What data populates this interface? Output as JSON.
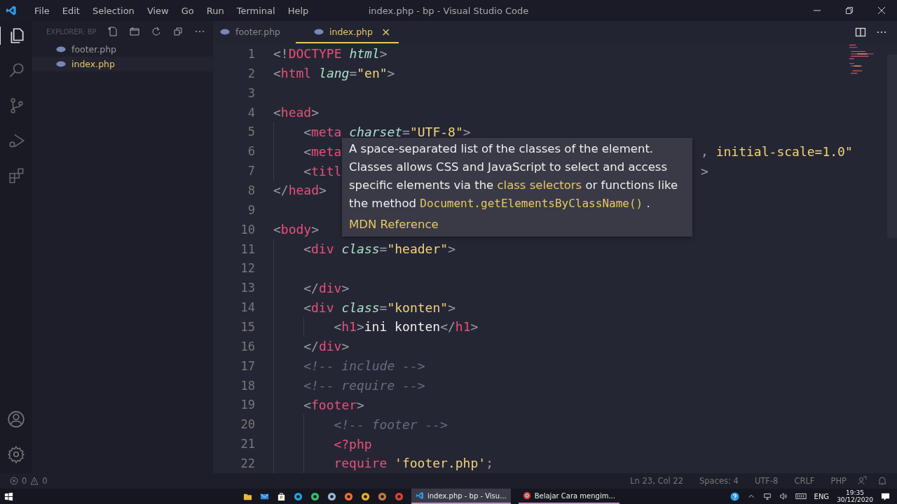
{
  "window": {
    "title": "index.php - bp - Visual Studio Code"
  },
  "menu": [
    "File",
    "Edit",
    "Selection",
    "View",
    "Go",
    "Run",
    "Terminal",
    "Help"
  ],
  "activity_bar": [
    {
      "kind": "files",
      "selected": true
    },
    {
      "kind": "search",
      "selected": false
    },
    {
      "kind": "branch",
      "selected": false
    },
    {
      "kind": "debug",
      "selected": false
    },
    {
      "kind": "extensions",
      "selected": false
    }
  ],
  "sidebar": {
    "title": "EXPLORER: BP",
    "files": [
      {
        "name": "footer.php",
        "selected": false
      },
      {
        "name": "index.php",
        "selected": true
      }
    ]
  },
  "tabs": [
    {
      "label": "footer.php",
      "selected": false
    },
    {
      "label": "index.php",
      "selected": true,
      "close": "×"
    }
  ],
  "code": [
    {
      "num": "1",
      "tokens": [
        {
          "kind": "p",
          "t": "<!"
        },
        {
          "kind": "tag",
          "t": "DOCTYPE"
        },
        {
          "kind": "attr",
          "t": " html"
        },
        {
          "kind": "p",
          "t": ">"
        }
      ]
    },
    {
      "num": "2",
      "tokens": [
        {
          "kind": "p",
          "t": "<"
        },
        {
          "kind": "tag",
          "t": "html"
        },
        {
          "kind": "attr",
          "t": " lang"
        },
        {
          "kind": "p",
          "t": "="
        },
        {
          "kind": "str",
          "t": "\"en\""
        },
        {
          "kind": "p",
          "t": ">"
        }
      ]
    },
    {
      "num": "3"
    },
    {
      "num": "4",
      "tokens": [
        {
          "kind": "p",
          "t": "<"
        },
        {
          "kind": "tag",
          "t": "head"
        },
        {
          "kind": "p",
          "t": ">"
        }
      ],
      "children": [
        {
          "num": "5",
          "tokens": [
            {
              "kind": "p",
              "t": "<"
            },
            {
              "kind": "tag",
              "t": "meta"
            },
            {
              "kind": "attr",
              "t": " charset"
            },
            {
              "kind": "p",
              "t": "="
            },
            {
              "kind": "str",
              "t": "\"UTF-8\""
            },
            {
              "kind": "p",
              "t": ">"
            }
          ]
        },
        {
          "num": "6",
          "tokens": [
            {
              "kind": "p",
              "t": "<"
            },
            {
              "kind": "tag",
              "t": "meta"
            }
          ],
          "tail": [
            {
              "kind": "p",
              "t": ", "
            },
            {
              "kind": "str",
              "t": "initial-scale=1.0\""
            }
          ]
        },
        {
          "num": "7",
          "tokens": [
            {
              "kind": "p",
              "t": "<"
            },
            {
              "kind": "tag",
              "t": "titl"
            }
          ],
          "tail": [
            {
              "kind": "p",
              "t": ">"
            }
          ]
        }
      ]
    },
    {
      "num": "8",
      "tokens": [
        {
          "kind": "p",
          "t": "</"
        },
        {
          "kind": "tag",
          "t": "head"
        },
        {
          "kind": "p",
          "t": ">"
        }
      ]
    },
    {
      "num": "9"
    },
    {
      "num": "10",
      "tokens": [
        {
          "kind": "p",
          "t": "<"
        },
        {
          "kind": "tag",
          "t": "body"
        },
        {
          "kind": "p",
          "t": ">"
        }
      ],
      "children": [
        {
          "num": "11",
          "tokens": [
            {
              "kind": "p",
              "t": "<"
            },
            {
              "kind": "tag",
              "t": "div"
            },
            {
              "kind": "attr",
              "t": " class"
            },
            {
              "kind": "p",
              "t": "="
            },
            {
              "kind": "str",
              "t": "\"header\""
            },
            {
              "kind": "p",
              "t": ">"
            }
          ]
        },
        {
          "num": "12"
        },
        {
          "num": "13",
          "tokens": [
            {
              "kind": "p",
              "t": "</"
            },
            {
              "kind": "tag",
              "t": "div"
            },
            {
              "kind": "p",
              "t": ">"
            }
          ]
        },
        {
          "num": "14",
          "tokens": [
            {
              "kind": "p",
              "t": "<"
            },
            {
              "kind": "tag",
              "t": "div"
            },
            {
              "kind": "attr",
              "t": " class"
            },
            {
              "kind": "p",
              "t": "="
            },
            {
              "kind": "str",
              "t": "\"konten\""
            },
            {
              "kind": "p",
              "t": ">"
            }
          ],
          "children": [
            {
              "num": "15",
              "tokens": [
                {
                  "kind": "p",
                  "t": "<"
                },
                {
                  "kind": "tag",
                  "t": "h1"
                },
                {
                  "kind": "p",
                  "t": ">"
                },
                {
                  "kind": "x",
                  "t": "ini konten"
                },
                {
                  "kind": "p",
                  "t": "</"
                },
                {
                  "kind": "tag",
                  "t": "h1"
                },
                {
                  "kind": "p",
                  "t": ">"
                }
              ]
            }
          ]
        },
        {
          "num": "16",
          "tokens": [
            {
              "kind": "p",
              "t": "</"
            },
            {
              "kind": "tag",
              "t": "div"
            },
            {
              "kind": "p",
              "t": ">"
            }
          ]
        },
        {
          "num": "17",
          "tokens": [
            {
              "kind": "c",
              "t": "<!-- include -->"
            }
          ]
        },
        {
          "num": "18",
          "tokens": [
            {
              "kind": "c",
              "t": "<!-- require -->"
            }
          ]
        },
        {
          "num": "19",
          "tokens": [
            {
              "kind": "p",
              "t": "<"
            },
            {
              "kind": "tag",
              "t": "footer"
            },
            {
              "kind": "p",
              "t": ">"
            }
          ],
          "children": [
            {
              "num": "20",
              "tokens": [
                {
                  "kind": "c",
                  "t": "<!-- footer -->"
                }
              ]
            },
            {
              "num": "21",
              "tokens": [
                {
                  "kind": "tag",
                  "t": "<?php"
                }
              ]
            },
            {
              "num": "22",
              "tokens": [
                {
                  "kind": "tag",
                  "t": "require"
                },
                {
                  "kind": "str",
                  "t": " 'footer.php'"
                },
                {
                  "kind": "p",
                  "t": ";"
                }
              ]
            }
          ]
        }
      ]
    }
  ],
  "hover": {
    "parts": [
      {
        "kind": "text",
        "t": "A space-separated list of the classes of the element. Classes allows CSS and JavaScript to select and access specific elements via the "
      },
      {
        "kind": "link",
        "t": "class selectors"
      },
      {
        "kind": "text",
        "t": " or functions like the method "
      },
      {
        "kind": "code",
        "t": "Document.getElementsByClassName()"
      },
      {
        "kind": "text",
        "t": " ."
      }
    ],
    "reference": "MDN Reference"
  },
  "status_bar": {
    "errors": "0",
    "warnings": "0",
    "items": [
      "Ln 23, Col 22",
      "Spaces: 4",
      "UTF-8",
      "CRLF",
      "PHP"
    ]
  },
  "taskbar": {
    "apps": [
      {
        "kind": "folder",
        "color": "#e8b93a"
      },
      {
        "kind": "mail",
        "color": "#2b8ae0"
      },
      {
        "kind": "store",
        "color": "#ffffff"
      },
      {
        "kind": "app",
        "color": "#1fa3e0"
      },
      {
        "kind": "app",
        "color": "#2ec46a"
      },
      {
        "kind": "app",
        "color": "#9ab8d8"
      },
      {
        "kind": "app",
        "color": "#f0702a"
      },
      {
        "kind": "app",
        "color": "#e8b020"
      },
      {
        "kind": "app",
        "color": "#c87a3a"
      },
      {
        "kind": "app",
        "color": "#e04030"
      }
    ],
    "windows": [
      {
        "label": "index.php - bp - Visu...",
        "kind": "editor",
        "selected": true
      },
      {
        "label": "Belajar Cara mengim...",
        "kind": "browser",
        "selected": false
      }
    ],
    "language": "ENG",
    "time": "19:35",
    "date": "30/12/2020"
  }
}
